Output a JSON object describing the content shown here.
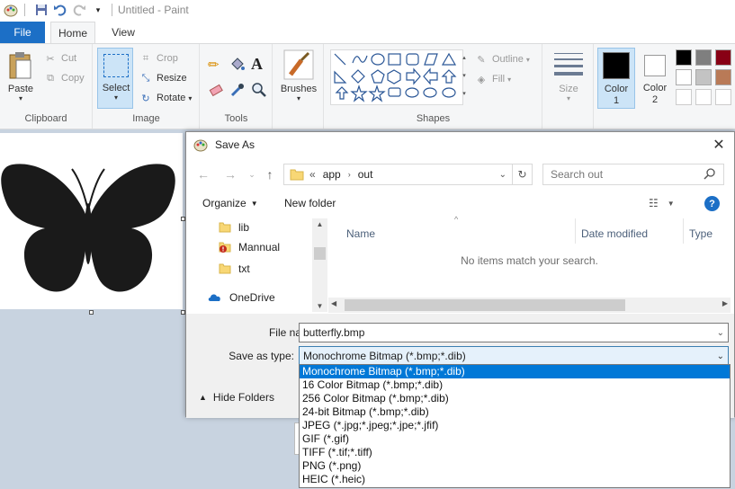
{
  "window": {
    "title": "Untitled - Paint"
  },
  "tabs": {
    "file": "File",
    "home": "Home",
    "view": "View"
  },
  "clipboard": {
    "paste": "Paste",
    "cut": "Cut",
    "copy": "Copy",
    "label": "Clipboard"
  },
  "image": {
    "select": "Select",
    "crop": "Crop",
    "resize": "Resize",
    "rotate": "Rotate",
    "label": "Image"
  },
  "tools": {
    "label": "Tools"
  },
  "brushes": {
    "label": "Brushes"
  },
  "shapes": {
    "outline": "Outline",
    "fill": "Fill",
    "label": "Shapes"
  },
  "size": {
    "label": "Size"
  },
  "colors": {
    "color1_line1": "Color",
    "color1_line2": "1",
    "color2_line1": "Color",
    "color2_line2": "2",
    "palette": [
      "#000000",
      "#7f7f7f",
      "#880015",
      "#ffffff",
      "#c3c3c3",
      "#b97a57"
    ]
  },
  "dialog": {
    "title": "Save As",
    "path": [
      "app",
      "out"
    ],
    "search_placeholder": "Search out",
    "organize": "Organize",
    "new_folder": "New folder",
    "nav_items": [
      "lib",
      "Mannual",
      "txt",
      "OneDrive"
    ],
    "columns": [
      "Name",
      "Date modified",
      "Type"
    ],
    "empty_message": "No items match your search.",
    "file_name_label": "File name:",
    "file_name_value": "butterfly.bmp",
    "save_type_label": "Save as type:",
    "save_type_value": "Monochrome Bitmap (*.bmp;*.dib)",
    "hide_folders": "Hide Folders"
  },
  "save_types": [
    "Monochrome Bitmap (*.bmp;*.dib)",
    "16 Color Bitmap (*.bmp;*.dib)",
    "256 Color Bitmap (*.bmp;*.dib)",
    "24-bit Bitmap (*.bmp;*.dib)",
    "JPEG (*.jpg;*.jpeg;*.jpe;*.jfif)",
    "GIF (*.gif)",
    "TIFF (*.tif;*.tiff)",
    "PNG (*.png)",
    "HEIC (*.heic)"
  ]
}
